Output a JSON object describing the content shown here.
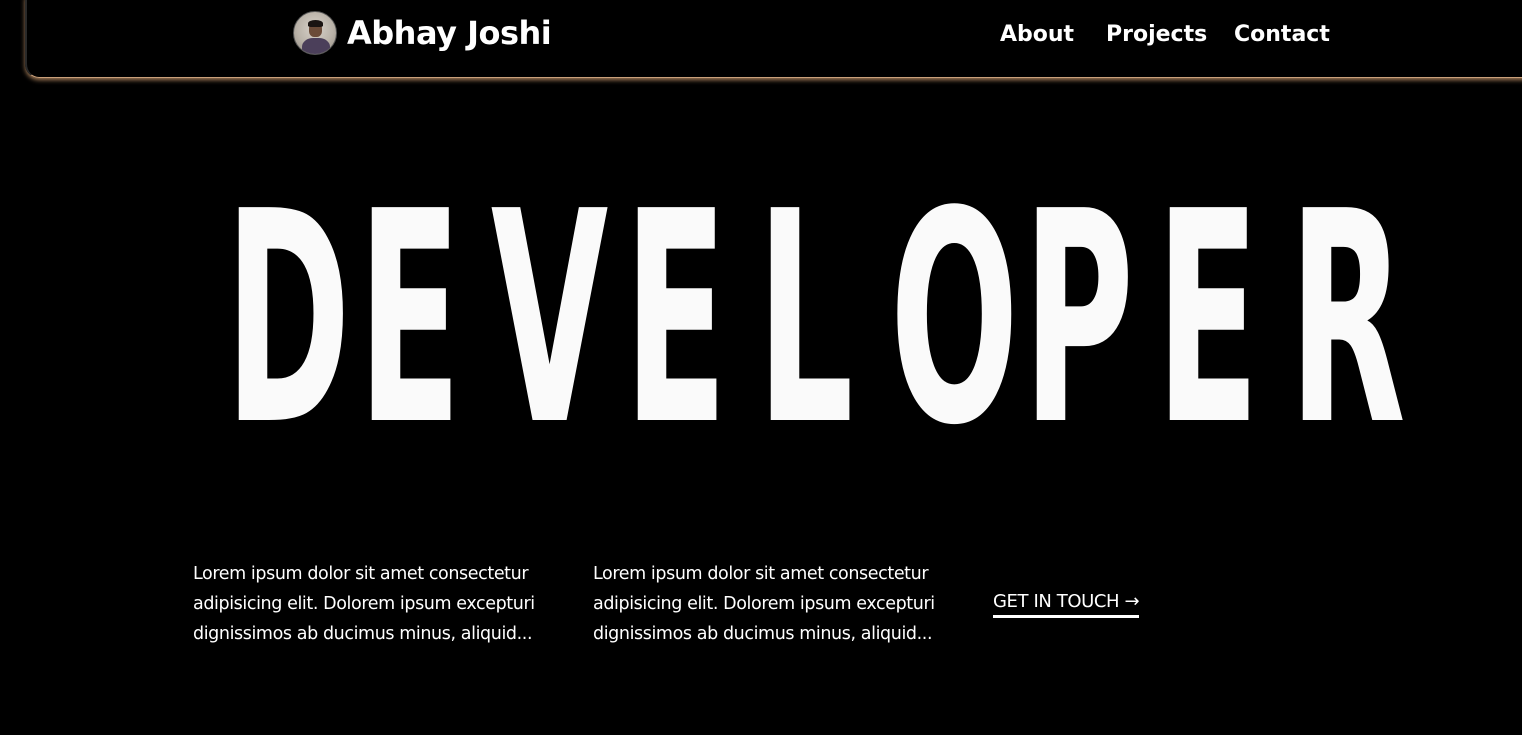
{
  "header": {
    "brand_name": "Abhay Joshi",
    "nav": [
      {
        "label": "About"
      },
      {
        "label": "Projects"
      },
      {
        "label": "Contact"
      }
    ]
  },
  "hero": {
    "title_letters": [
      "D",
      "E",
      "V",
      "E",
      "L",
      "O",
      "P",
      "E",
      "R"
    ]
  },
  "content": {
    "paragraph_1": "Lorem ipsum dolor sit amet consectetur adipisicing elit. Dolorem ipsum excepturi dignissimos ab ducimus minus, aliquid...",
    "paragraph_2": "Lorem ipsum dolor sit amet consectetur adipisicing elit. Dolorem ipsum excepturi dignissimos ab ducimus minus, aliquid...",
    "cta_label": "GET IN TOUCH →"
  },
  "colors": {
    "background": "#000000",
    "text": "#ffffff",
    "header_glow": "#caa07a"
  }
}
